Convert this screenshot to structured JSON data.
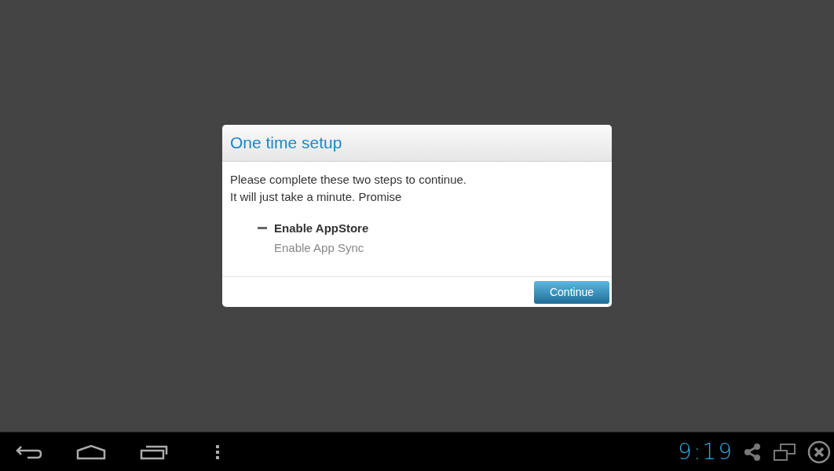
{
  "dialog": {
    "title": "One time setup",
    "message_lines": [
      "Please complete these two steps to continue.",
      "It will just take a minute. Promise"
    ],
    "steps": [
      {
        "label": "Enable AppStore",
        "active": true
      },
      {
        "label": "Enable App Sync",
        "active": false
      }
    ],
    "button": "Continue"
  },
  "nav_bar": {
    "clock": "9:19"
  }
}
